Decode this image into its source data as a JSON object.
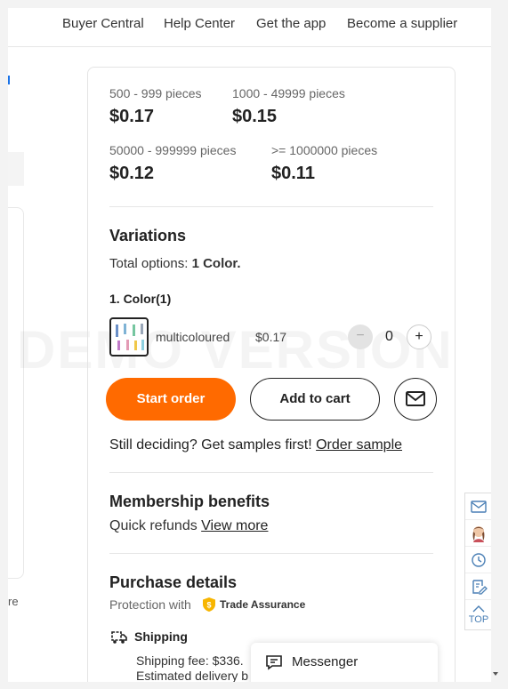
{
  "nav": {
    "links": [
      "Buyer Central",
      "Help Center",
      "Get the app",
      "Become a supplier"
    ]
  },
  "left_fragment": {
    "text": "re"
  },
  "price_tiers": [
    {
      "range": "500 - 999 pieces",
      "price": "$0.17"
    },
    {
      "range": "1000 - 49999 pieces",
      "price": "$0.15"
    },
    {
      "range": "50000 - 999999 pieces",
      "price": "$0.12"
    },
    {
      "range": ">= 1000000 pieces",
      "price": "$0.11"
    }
  ],
  "variations": {
    "title": "Variations",
    "total_prefix": "Total options: ",
    "total_value": "1 Color.",
    "color_group": "1. Color(1)",
    "option": {
      "name": "multicoloured",
      "price": "$0.17",
      "quantity": "0"
    }
  },
  "actions": {
    "start_order": "Start order",
    "add_to_cart": "Add to cart"
  },
  "samples": {
    "text": "Still deciding? Get samples first! ",
    "link": "Order sample"
  },
  "membership": {
    "title": "Membership benefits",
    "text": "Quick refunds ",
    "link": "View more"
  },
  "purchase": {
    "title": "Purchase details",
    "protection_prefix": "Protection with",
    "trade_assurance": "Trade Assurance",
    "shipping_title": "Shipping",
    "shipping_fee": "Shipping fee: $336.",
    "delivery": "Estimated delivery b"
  },
  "side_tools": {
    "top_label": "TOP"
  },
  "messenger": {
    "label": "Messenger"
  },
  "watermark": "DEMO VERSION",
  "colors": {
    "accent": "#ff6a00",
    "trade_assurance": "#f7b500",
    "side_icon": "#4a7fb5"
  }
}
